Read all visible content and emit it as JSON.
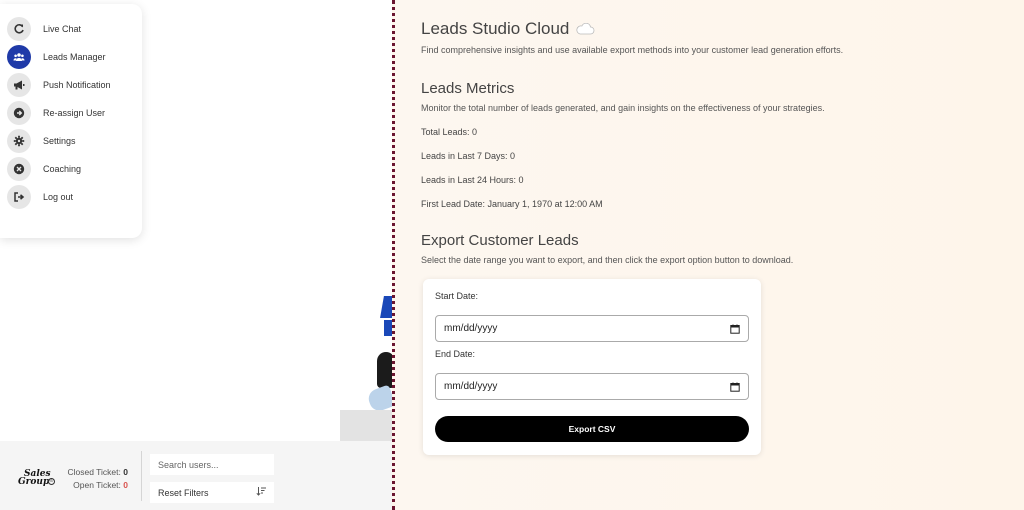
{
  "menu": {
    "items": [
      {
        "label": "Live Chat",
        "icon": "refresh-icon"
      },
      {
        "label": "Leads Manager",
        "icon": "users-icon"
      },
      {
        "label": "Push Notification",
        "icon": "megaphone-icon"
      },
      {
        "label": "Re-assign User",
        "icon": "arrow-right-circle-icon"
      },
      {
        "label": "Settings",
        "icon": "gear-icon"
      },
      {
        "label": "Coaching",
        "icon": "close-circle-icon"
      },
      {
        "label": "Log out",
        "icon": "logout-icon"
      }
    ],
    "active_index": 1
  },
  "footer": {
    "logo_text_line1": "Sales",
    "logo_text_line2": "Group",
    "logo_badge": "®",
    "closed_ticket_label": "Closed Ticket:",
    "closed_ticket_count": "0",
    "open_ticket_label": "Open Ticket:",
    "open_ticket_count": "0",
    "search_placeholder": "Search users...",
    "reset_label": "Reset Filters"
  },
  "panel": {
    "title": "Leads Studio Cloud",
    "subtitle": "Find comprehensive insights and use available export methods into your customer lead generation efforts.",
    "metrics_title": "Leads Metrics",
    "metrics_subtitle": "Monitor the total number of leads generated, and gain insights on the effectiveness of your strategies.",
    "metrics": {
      "total": "Total Leads: 0",
      "last7": "Leads in Last 7 Days: 0",
      "last24": "Leads in Last 24 Hours: 0",
      "first": "First Lead Date: January 1, 1970 at 12:00 AM"
    },
    "export_title": "Export Customer Leads",
    "export_subtitle": "Select the date range you want to export, and then click the export option button to download.",
    "start_label": "Start Date:",
    "start_value": "mm/dd/yyyy",
    "end_label": "End Date:",
    "end_value": "mm/dd/yyyy",
    "export_button": "Export CSV"
  },
  "colors": {
    "accent": "#1f3aa8",
    "divider": "#6a1530",
    "open_ticket": "#d9534f"
  }
}
